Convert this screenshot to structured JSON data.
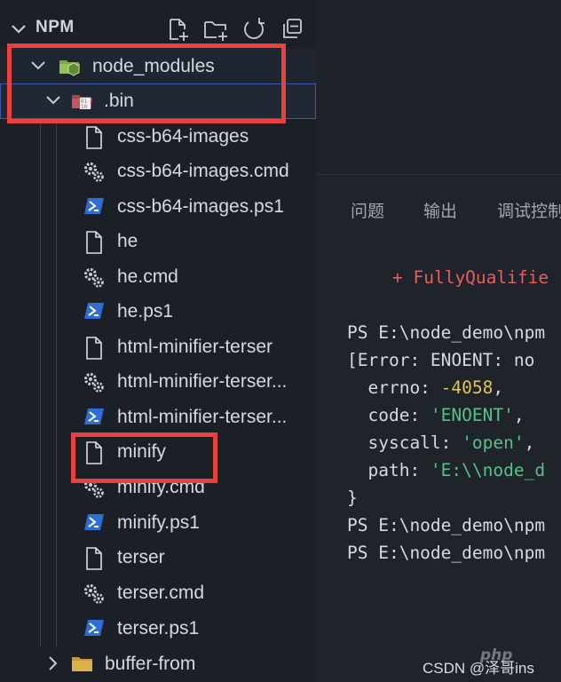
{
  "explorer": {
    "title": "NPM",
    "actions": [
      "new-file-icon",
      "new-folder-icon",
      "refresh-icon",
      "collapse-all-icon"
    ],
    "tree": [
      {
        "name": "node_modules",
        "type": "folder-open",
        "icon": "folder-node-icon",
        "depth": 0
      },
      {
        "name": ".bin",
        "type": "folder-open",
        "icon": "folder-binary-icon",
        "depth": 1,
        "selected": true
      },
      {
        "name": "css-b64-images",
        "type": "file",
        "icon": "file-icon",
        "depth": 2
      },
      {
        "name": "css-b64-images.cmd",
        "type": "file",
        "icon": "gear-icon",
        "depth": 2
      },
      {
        "name": "css-b64-images.ps1",
        "type": "file",
        "icon": "powershell-icon",
        "depth": 2
      },
      {
        "name": "he",
        "type": "file",
        "icon": "file-icon",
        "depth": 2
      },
      {
        "name": "he.cmd",
        "type": "file",
        "icon": "gear-icon",
        "depth": 2
      },
      {
        "name": "he.ps1",
        "type": "file",
        "icon": "powershell-icon",
        "depth": 2
      },
      {
        "name": "html-minifier-terser",
        "type": "file",
        "icon": "file-icon",
        "depth": 2
      },
      {
        "name": "html-minifier-terser...",
        "type": "file",
        "icon": "gear-icon",
        "depth": 2
      },
      {
        "name": "html-minifier-terser...",
        "type": "file",
        "icon": "powershell-icon",
        "depth": 2
      },
      {
        "name": "minify",
        "type": "file",
        "icon": "file-icon",
        "depth": 2
      },
      {
        "name": "minify.cmd",
        "type": "file",
        "icon": "gear-icon",
        "depth": 2
      },
      {
        "name": "minify.ps1",
        "type": "file",
        "icon": "powershell-icon",
        "depth": 2
      },
      {
        "name": "terser",
        "type": "file",
        "icon": "file-icon",
        "depth": 2
      },
      {
        "name": "terser.cmd",
        "type": "file",
        "icon": "gear-icon",
        "depth": 2
      },
      {
        "name": "terser.ps1",
        "type": "file",
        "icon": "powershell-icon",
        "depth": 2
      },
      {
        "name": "buffer-from",
        "type": "folder-closed",
        "icon": "folder-icon",
        "depth": 1
      }
    ]
  },
  "panel": {
    "tabs": [
      "问题",
      "输出",
      "调试控制"
    ]
  },
  "terminal": {
    "error_fragment": "+ FullyQualifie",
    "prompt1": "PS E:\\node_demo\\npm",
    "error_head": "[Error: ENOENT: no",
    "errno_key": "  errno: ",
    "errno_val": "-4058",
    "errno_tail": ",",
    "code_key": "  code: ",
    "code_val": "'ENOENT'",
    "code_tail": ",",
    "syscall_key": "  syscall: ",
    "syscall_val": "'open'",
    "syscall_tail": ",",
    "path_key": "  path: ",
    "path_val": "'E:\\\\node_d",
    "close": "}",
    "prompt2": "PS E:\\node_demo\\npm",
    "prompt3": "PS E:\\node_demo\\npm"
  },
  "watermark": {
    "site": "php",
    "text": "CSDN @泽哥ins"
  },
  "colors": {
    "highlight_box": "#e8413f",
    "terminal_error": "#e65e5e",
    "terminal_number": "#e5c35b",
    "terminal_string": "#56c28a",
    "selection_outline": "#3a5aa8"
  }
}
